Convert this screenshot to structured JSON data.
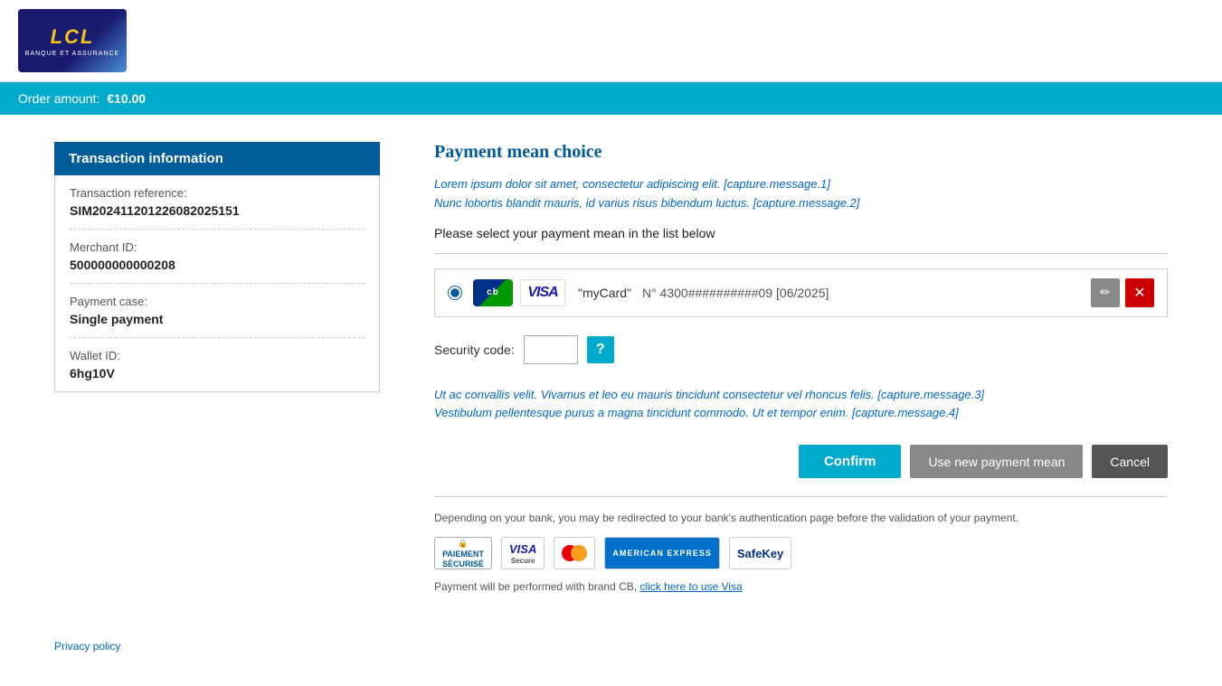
{
  "logo": {
    "text": "LCL",
    "sub": "BANQUE ET ASSURANCE"
  },
  "order_bar": {
    "label": "Order amount:",
    "amount": "€10.00"
  },
  "sidebar": {
    "title": "Transaction information",
    "rows": [
      {
        "label": "Transaction reference:",
        "value": "SIM202411201226082025151"
      },
      {
        "label": "Merchant ID:",
        "value": "500000000000208"
      },
      {
        "label": "Payment case:",
        "value": "Single payment"
      },
      {
        "label": "Wallet ID:",
        "value": "6hg10V"
      }
    ]
  },
  "content": {
    "title": "Payment mean choice",
    "info_message_1": "Lorem ipsum dolor sit amet, consectetur adipiscing elit. [capture.message.1]",
    "info_message_2": "Nunc lobortis blandit mauris, id varius risus bibendum luctus. [capture.message.2]",
    "select_prompt": "Please select your payment mean in the list below",
    "card": {
      "name": "\"myCard\"",
      "number": "N° 4300##########09 [06/2025]"
    },
    "security_code": {
      "label": "Security code:",
      "placeholder": "",
      "help_char": "?"
    },
    "capture_message_3": "Ut ac convallis velit. Vivamus et leo eu mauris tincidunt consectetur vel rhoncus felis. [capture.message.3]",
    "capture_message_4": "Vestibulum pellentesque purus a magna tincidunt commodo. Ut et tempor enim. [capture.message.4]",
    "buttons": {
      "confirm": "Confirm",
      "new_payment": "Use new payment mean",
      "cancel": "Cancel"
    },
    "redirect_note": "Depending on your bank, you may be redirected to your bank's authentication page before the validation of your payment.",
    "brand_note_prefix": "Payment will be performed with brand CB,",
    "brand_note_link": "click here to use Visa"
  },
  "footer": {
    "privacy_label": "Privacy policy"
  }
}
